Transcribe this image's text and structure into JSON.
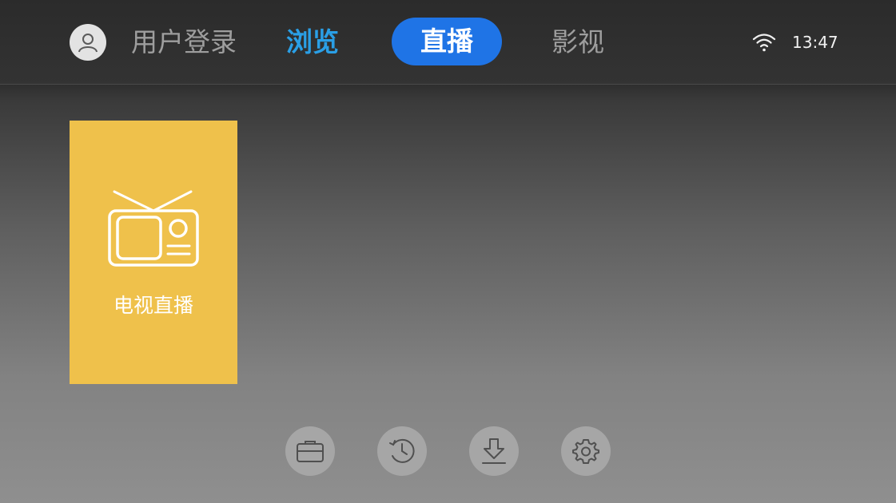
{
  "header": {
    "avatar_icon": "user-icon",
    "nav": {
      "login_label": "用户登录",
      "browse_label": "浏览",
      "live_label": "直播",
      "movies_label": "影视"
    },
    "status": {
      "wifi_icon": "wifi-icon",
      "time": "13:47"
    }
  },
  "main": {
    "tiles": [
      {
        "label": "电视直播",
        "icon": "tv-icon",
        "color": "#efc14b"
      }
    ]
  },
  "bottom_bar": {
    "buttons": [
      {
        "icon": "folder-icon"
      },
      {
        "icon": "history-icon"
      },
      {
        "icon": "download-icon"
      },
      {
        "icon": "gear-icon"
      }
    ]
  },
  "colors": {
    "accent_blue": "#2a9fe6",
    "selected_pill": "#1f74e6",
    "inactive_text": "#9e9e9e"
  }
}
